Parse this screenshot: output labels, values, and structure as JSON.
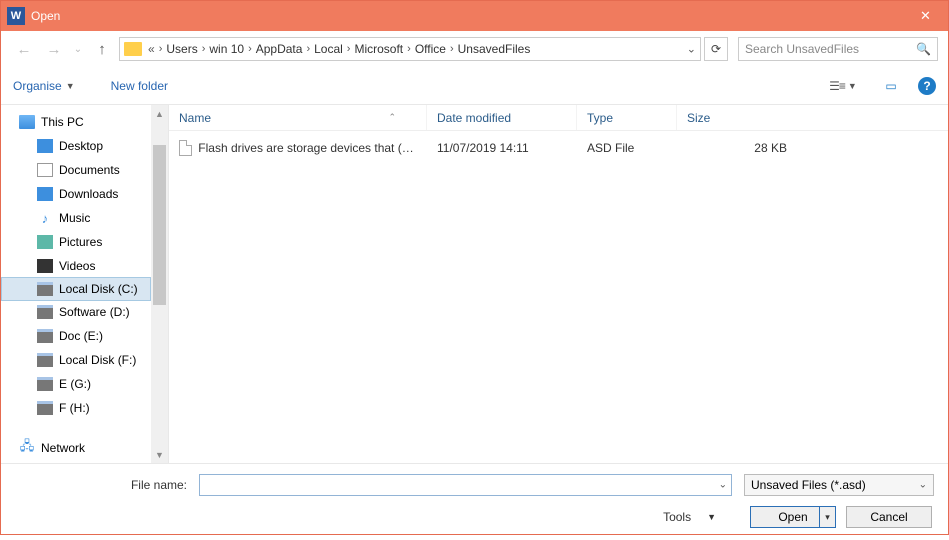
{
  "window": {
    "title": "Open"
  },
  "breadcrumb": {
    "ellipsis": "«",
    "segments": [
      "Users",
      "win 10",
      "AppData",
      "Local",
      "Microsoft",
      "Office",
      "UnsavedFiles"
    ]
  },
  "search": {
    "placeholder": "Search UnsavedFiles"
  },
  "toolbar": {
    "organise": "Organise",
    "new_folder": "New folder"
  },
  "tree": {
    "this_pc": "This PC",
    "desktop": "Desktop",
    "documents": "Documents",
    "downloads": "Downloads",
    "music": "Music",
    "pictures": "Pictures",
    "videos": "Videos",
    "local_c": "Local Disk (C:)",
    "software_d": "Software (D:)",
    "doc_e": "Doc (E:)",
    "local_f": "Local Disk (F:)",
    "e_g": "E (G:)",
    "f_h": "F (H:)",
    "network": "Network"
  },
  "columns": {
    "name": "Name",
    "date": "Date modified",
    "type": "Type",
    "size": "Size"
  },
  "files": [
    {
      "name": "Flash drives are storage devices that ((Un...",
      "date": "11/07/2019 14:11",
      "type": "ASD File",
      "size": "28 KB"
    }
  ],
  "bottom": {
    "filename_label": "File name:",
    "filetype": "Unsaved Files (*.asd)",
    "tools": "Tools",
    "open": "Open",
    "cancel": "Cancel"
  }
}
